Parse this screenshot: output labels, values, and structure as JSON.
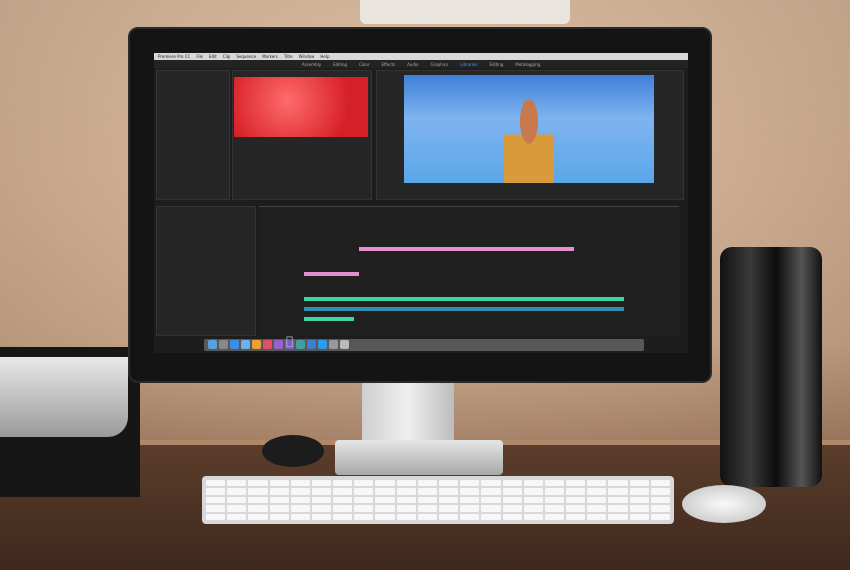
{
  "app": {
    "menu": [
      "Premiere Pro CC",
      "File",
      "Edit",
      "Clip",
      "Sequence",
      "Markers",
      "Title",
      "Window",
      "Help"
    ],
    "workspaces": [
      "Assembly",
      "Editing",
      "Color",
      "Effects",
      "Audio",
      "Graphics",
      "Libraries",
      "Editing",
      "Metalogging"
    ],
    "active_workspace_index": 6
  },
  "colors": {
    "accent": "#3aa0ff",
    "clip_pink": "#e58fd0",
    "clip_green": "#3dd6a0",
    "clip_teal": "#2f8fb0"
  },
  "dock_icons": [
    "finder",
    "launchpad",
    "safari",
    "mail",
    "photos",
    "itunes",
    "premiere",
    "after-effects",
    "speedgrade",
    "lightroom",
    "photoshop",
    "system-preferences",
    "trash"
  ]
}
